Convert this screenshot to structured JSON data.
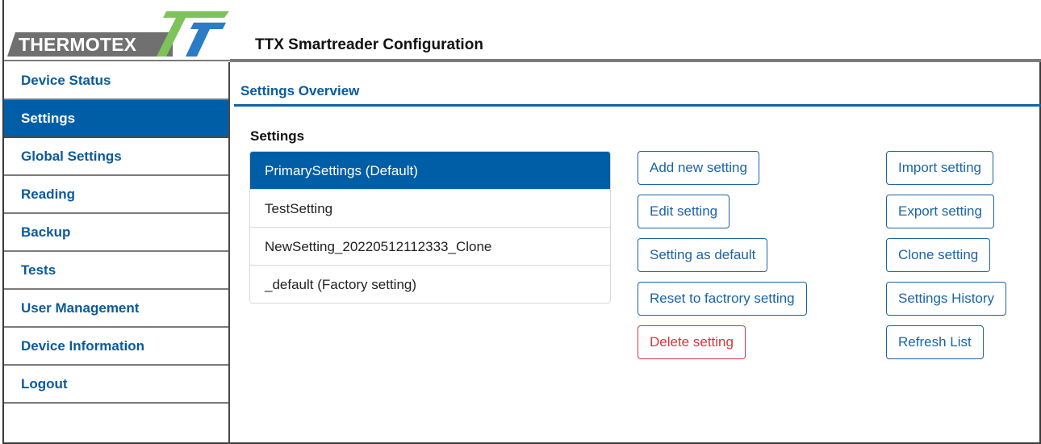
{
  "header": {
    "logo_text": "THERMOTEX",
    "app_title": "TTX Smartreader Configuration",
    "brand_green": "#7ec35a",
    "brand_blue": "#2b7bc7"
  },
  "sidebar": {
    "items": [
      {
        "label": "Device Status",
        "active": false
      },
      {
        "label": "Settings",
        "active": true
      },
      {
        "label": "Global Settings",
        "active": false
      },
      {
        "label": "Reading",
        "active": false
      },
      {
        "label": "Backup",
        "active": false
      },
      {
        "label": "Tests",
        "active": false
      },
      {
        "label": "User Management",
        "active": false
      },
      {
        "label": "Device Information",
        "active": false
      },
      {
        "label": "Logout",
        "active": false
      }
    ]
  },
  "main": {
    "section_title": "Settings Overview",
    "settings_label": "Settings",
    "settings": [
      {
        "label": "PrimarySettings (Default)",
        "selected": true
      },
      {
        "label": "TestSetting",
        "selected": false
      },
      {
        "label": "NewSetting_20220512112333_Clone",
        "selected": false
      },
      {
        "label": "_default (Factory setting)",
        "selected": false
      }
    ],
    "buttons_left": [
      "Add new setting",
      "Edit setting",
      "Setting as default",
      "Reset to factrory setting",
      "Delete setting"
    ],
    "buttons_right": [
      "Import setting",
      "Export setting",
      "Clone setting",
      "Settings History",
      "Refresh List"
    ]
  }
}
